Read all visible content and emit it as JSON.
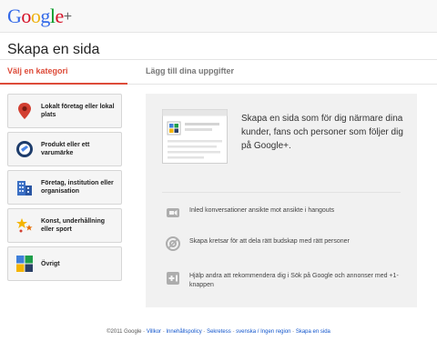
{
  "header": {
    "logo_letters": [
      "G",
      "o",
      "o",
      "g",
      "l",
      "e"
    ],
    "logo_plus": "+"
  },
  "page": {
    "title": "Skapa en sida"
  },
  "steps": {
    "step1": "Välj en kategori",
    "step2": "Lägg till dina uppgifter"
  },
  "categories": [
    {
      "label": "Lokalt företag eller lokal plats",
      "icon": "map-pin-icon"
    },
    {
      "label": "Produkt eller ett varumärke",
      "icon": "product-tag-icon"
    },
    {
      "label": "Företag, institution eller organisation",
      "icon": "building-icon"
    },
    {
      "label": "Konst, underhållning eller sport",
      "icon": "stars-icon"
    },
    {
      "label": "Övrigt",
      "icon": "other-squares-icon"
    }
  ],
  "panel": {
    "intro": "Skapa en sida som för dig närmare dina kunder, fans och personer som följer dig på Google+.",
    "features": [
      {
        "text": "Inled konversationer ansikte mot ansikte i hangouts",
        "icon": "hangouts-icon"
      },
      {
        "text": "Skapa kretsar för att dela rätt budskap med rätt personer",
        "icon": "circles-icon"
      },
      {
        "text": "Hjälp andra att rekommendera dig i Sök på Google och annonser med +1-knappen",
        "icon": "plus-one-icon"
      }
    ]
  },
  "footer": {
    "copyright": "©2011 Google",
    "links": [
      "Villkor",
      "Innehållspolicy",
      "Sekretess",
      "svenska / Ingen region",
      "Skapa en sida"
    ],
    "separator": " - "
  },
  "colors": {
    "accent_red": "#dd4b39",
    "link_blue": "#1155cc",
    "logo": [
      "#3369e8",
      "#d50f25",
      "#eeb211",
      "#3369e8",
      "#009925",
      "#d50f25"
    ]
  }
}
